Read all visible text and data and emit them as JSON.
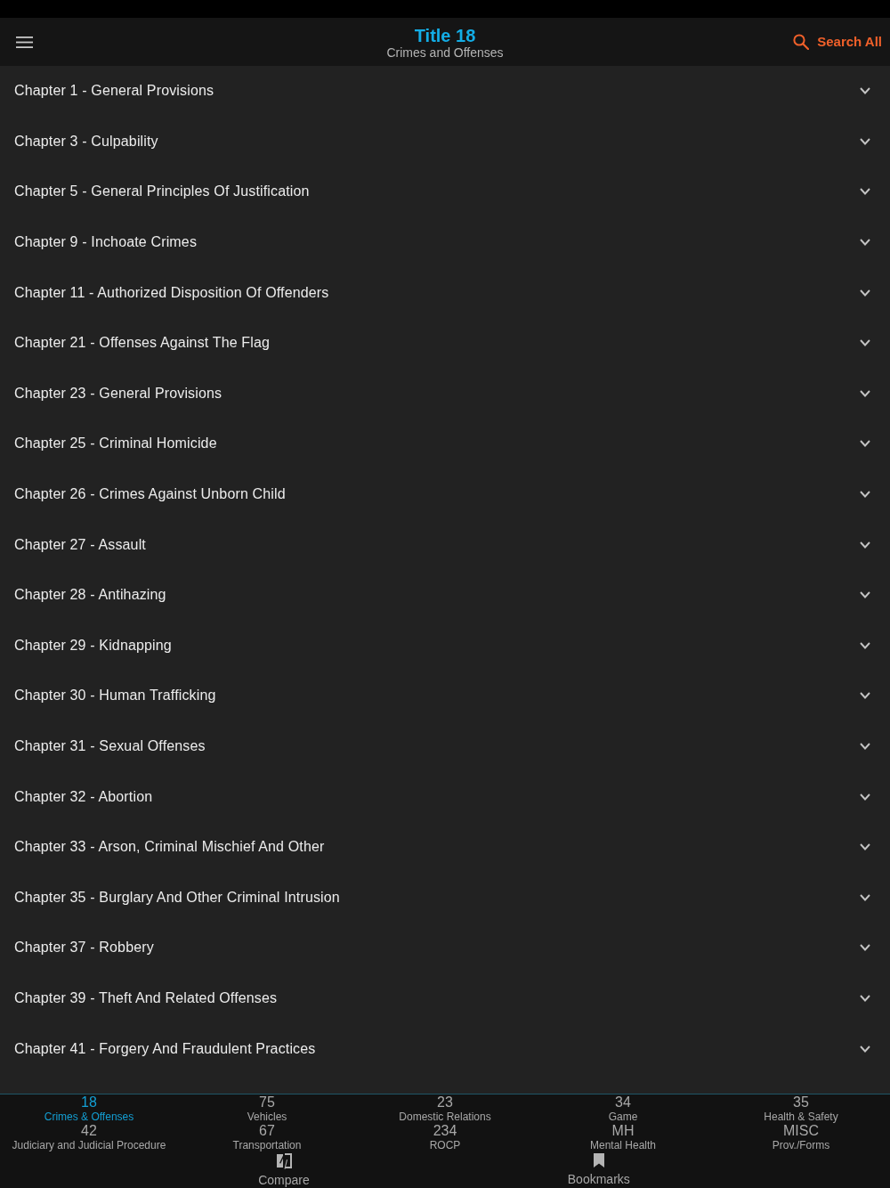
{
  "header": {
    "title": "Title 18",
    "subtitle": "Crimes and Offenses",
    "search_label": "Search All"
  },
  "chapters": [
    {
      "label": "Chapter 1 - General Provisions",
      "expanded": false
    },
    {
      "label": "Chapter 3 - Culpability",
      "expanded": false
    },
    {
      "label": "Chapter 5 - General Principles Of Justification",
      "expanded": false
    },
    {
      "label": "Chapter 9 - Inchoate Crimes",
      "expanded": false
    },
    {
      "label": "Chapter 11 - Authorized Disposition Of Offenders",
      "expanded": false
    },
    {
      "label": "Chapter 21 - Offenses Against The Flag",
      "expanded": false
    },
    {
      "label": "Chapter 23 - General Provisions",
      "expanded": false
    },
    {
      "label": "Chapter 25 - Criminal Homicide",
      "expanded": false
    },
    {
      "label": "Chapter 26 - Crimes Against Unborn Child",
      "expanded": false
    },
    {
      "label": "Chapter 27 - Assault",
      "expanded": false
    },
    {
      "label": "Chapter 28 - Antihazing",
      "expanded": false
    },
    {
      "label": "Chapter 29 - Kidnapping",
      "expanded": false
    },
    {
      "label": "Chapter 30 - Human Trafficking",
      "expanded": false
    },
    {
      "label": "Chapter 31 - Sexual Offenses",
      "expanded": false
    },
    {
      "label": "Chapter 32 - Abortion",
      "expanded": false
    },
    {
      "label": "Chapter 33 - Arson, Criminal Mischief And Other",
      "expanded": false
    },
    {
      "label": "Chapter 35 - Burglary And Other Criminal Intrusion",
      "expanded": false
    },
    {
      "label": "Chapter 37 - Robbery",
      "expanded": false
    },
    {
      "label": "Chapter 39 - Theft And Related Offenses",
      "expanded": false
    },
    {
      "label": "Chapter 41 - Forgery And Fraudulent Practices",
      "expanded": false
    }
  ],
  "title_tabs": [
    {
      "number": "18",
      "label": "Crimes & Offenses",
      "selected": true
    },
    {
      "number": "75",
      "label": "Vehicles",
      "selected": false
    },
    {
      "number": "23",
      "label": "Domestic Relations",
      "selected": false
    },
    {
      "number": "34",
      "label": "Game",
      "selected": false
    },
    {
      "number": "35",
      "label": "Health & Safety",
      "selected": false
    },
    {
      "number": "42",
      "label": "Judiciary and Judicial Procedure",
      "selected": false
    },
    {
      "number": "67",
      "label": "Transportation",
      "selected": false
    },
    {
      "number": "234",
      "label": "ROCP",
      "selected": false
    },
    {
      "number": "MH",
      "label": "Mental Health",
      "selected": false
    },
    {
      "number": "MISC",
      "label": "Prov./Forms",
      "selected": false
    }
  ],
  "tools": [
    {
      "kind": "compare",
      "label": "Compare"
    },
    {
      "kind": "bookmarks",
      "label": "Bookmarks"
    }
  ]
}
